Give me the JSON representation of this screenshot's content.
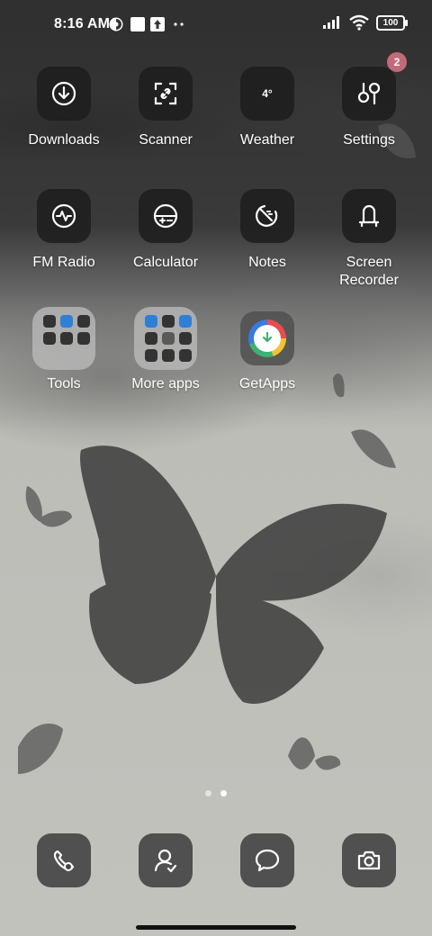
{
  "status_bar": {
    "time": "8:16 AM",
    "battery": "100"
  },
  "apps": [
    {
      "label": "Downloads",
      "icon": "download-icon"
    },
    {
      "label": "Scanner",
      "icon": "scanner-icon"
    },
    {
      "label": "Weather",
      "icon": "weather-icon",
      "temp": "4°"
    },
    {
      "label": "Settings",
      "icon": "settings-icon",
      "badge": "2"
    },
    {
      "label": "FM Radio",
      "icon": "radio-icon"
    },
    {
      "label": "Calculator",
      "icon": "calculator-icon"
    },
    {
      "label": "Notes",
      "icon": "notes-icon"
    },
    {
      "label": "Screen\nRecorder",
      "icon": "screen-recorder-icon"
    },
    {
      "label": "Tools",
      "icon": "folder-icon"
    },
    {
      "label": "More apps",
      "icon": "folder-icon"
    },
    {
      "label": "GetApps",
      "icon": "getapps-icon"
    }
  ],
  "dock": [
    {
      "icon": "phone-icon"
    },
    {
      "icon": "contacts-icon"
    },
    {
      "icon": "messages-icon"
    },
    {
      "icon": "camera-icon"
    }
  ],
  "page_indicator": {
    "pages": 2,
    "active": 2
  },
  "colors": {
    "badge": "#c26a7a",
    "icon_bg": "#1e1e1e"
  }
}
